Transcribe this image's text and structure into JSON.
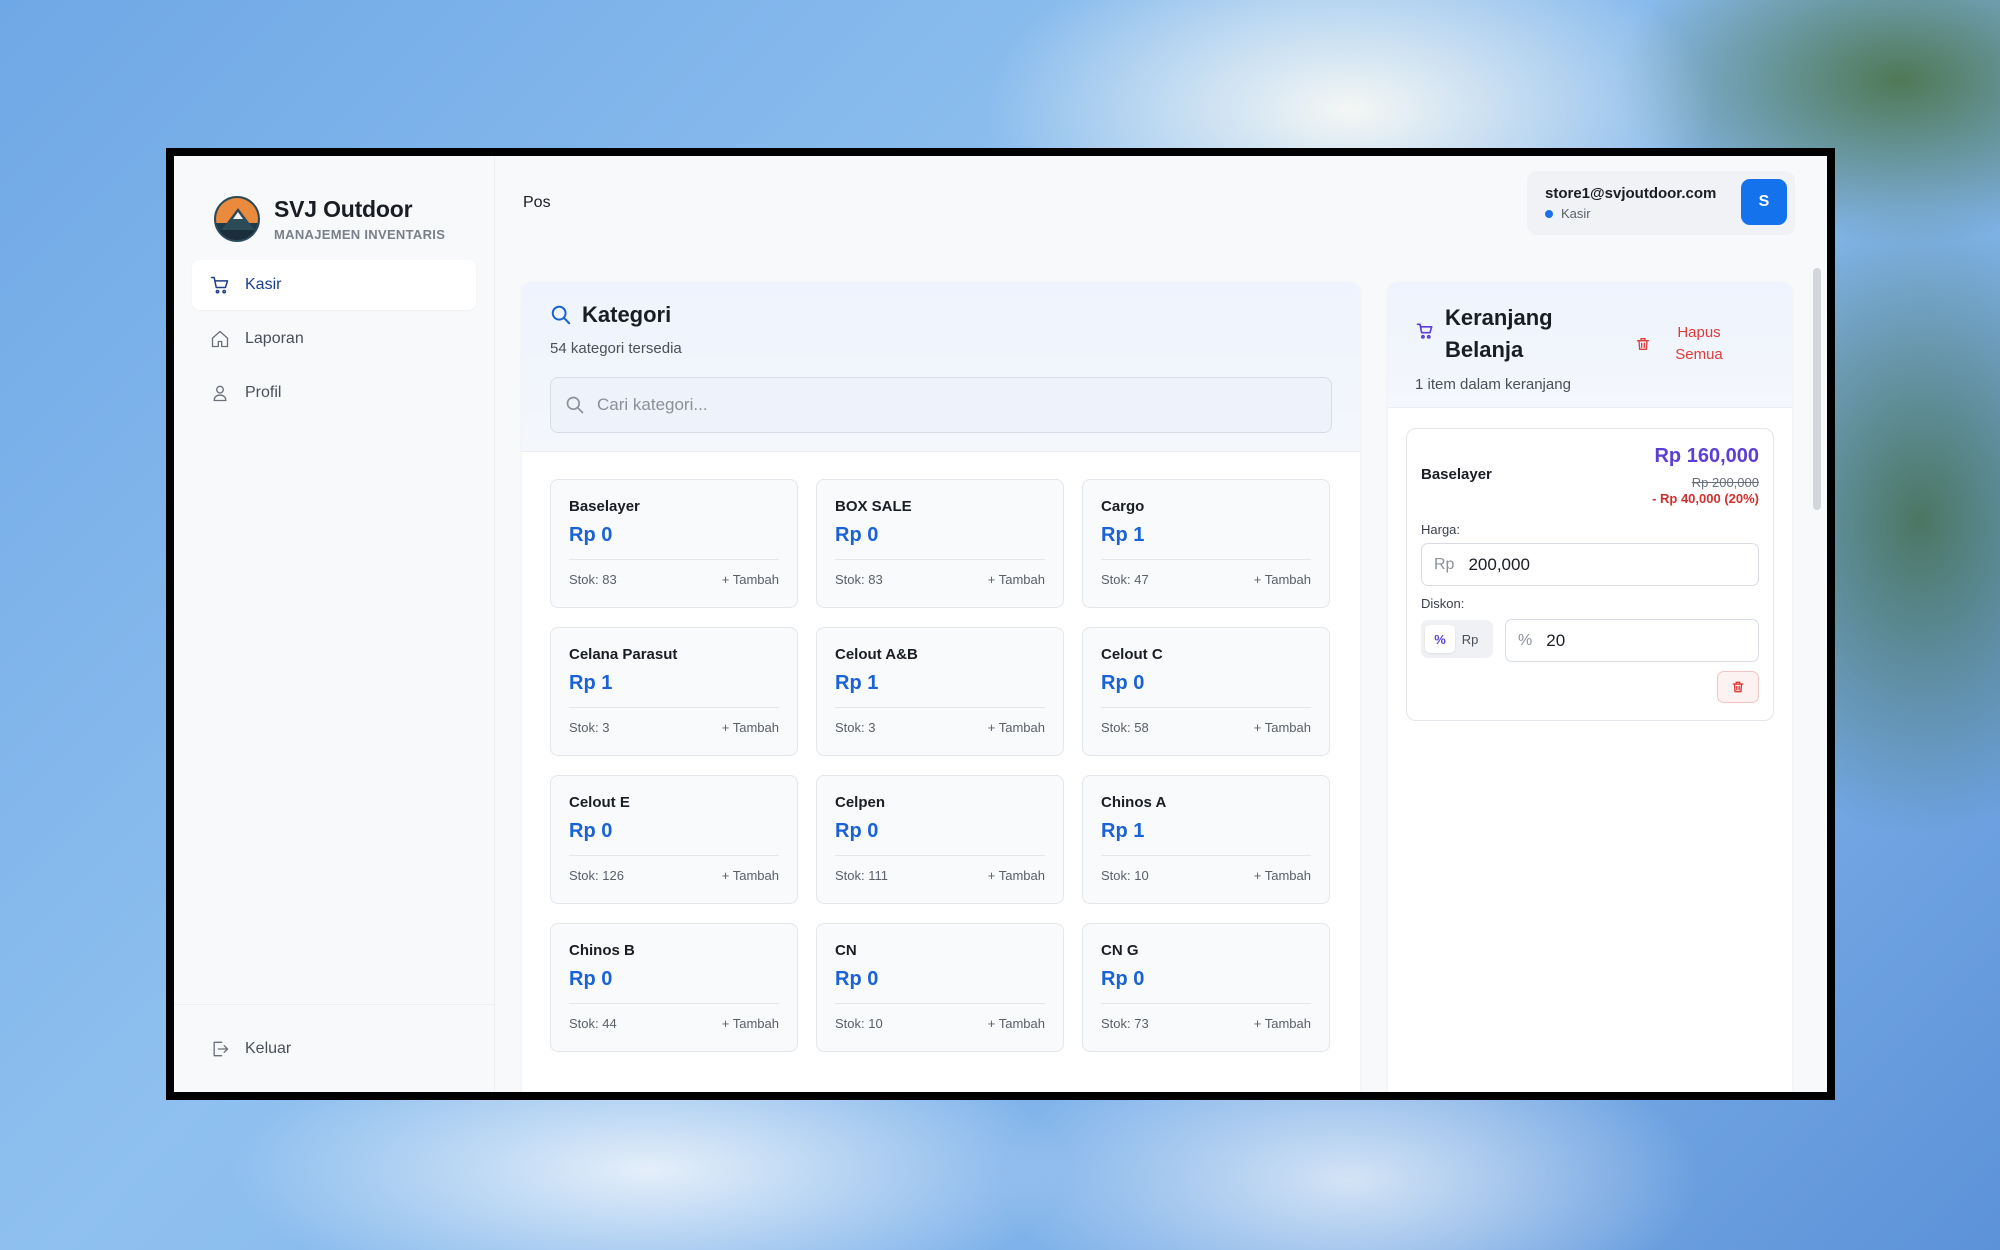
{
  "brand": {
    "title": "SVJ Outdoor",
    "subtitle": "MANAJEMEN INVENTARIS"
  },
  "sidebar": {
    "items": [
      {
        "label": "Kasir",
        "icon": "cart-icon",
        "active": true
      },
      {
        "label": "Laporan",
        "icon": "home-icon",
        "active": false
      },
      {
        "label": "Profil",
        "icon": "user-icon",
        "active": false
      }
    ],
    "logout_label": "Keluar"
  },
  "header": {
    "breadcrumb": "Pos",
    "user_email": "store1@svjoutdoor.com",
    "user_role": "Kasir",
    "avatar_initial": "S"
  },
  "categories": {
    "title": "Kategori",
    "count_text": "54 kategori tersedia",
    "search_placeholder": "Cari kategori...",
    "add_label": "+ Tambah",
    "items": [
      {
        "name": "Baselayer",
        "price": "Rp 0",
        "stock": "Stok: 83"
      },
      {
        "name": "BOX SALE",
        "price": "Rp 0",
        "stock": "Stok: 83"
      },
      {
        "name": "Cargo",
        "price": "Rp 1",
        "stock": "Stok: 47"
      },
      {
        "name": "Celana Parasut",
        "price": "Rp 1",
        "stock": "Stok: 3"
      },
      {
        "name": "Celout A&B",
        "price": "Rp 1",
        "stock": "Stok: 3"
      },
      {
        "name": "Celout C",
        "price": "Rp 0",
        "stock": "Stok: 58"
      },
      {
        "name": "Celout E",
        "price": "Rp 0",
        "stock": "Stok: 126"
      },
      {
        "name": "Celpen",
        "price": "Rp 0",
        "stock": "Stok: 111"
      },
      {
        "name": "Chinos A",
        "price": "Rp 1",
        "stock": "Stok: 10"
      },
      {
        "name": "Chinos B",
        "price": "Rp 0",
        "stock": "Stok: 44"
      },
      {
        "name": "CN",
        "price": "Rp 0",
        "stock": "Stok: 10"
      },
      {
        "name": "CN G",
        "price": "Rp 0",
        "stock": "Stok: 73"
      }
    ]
  },
  "cart": {
    "title": "Keranjang Belanja",
    "clear_label": "Hapus Semua",
    "count_text": "1 item dalam keranjang",
    "item": {
      "name": "Baselayer",
      "final_price": "Rp 160,000",
      "original_price": "Rp 200,000",
      "discount_text": "- Rp 40,000 (20%)",
      "price_label": "Harga:",
      "price_prefix": "Rp",
      "price_value": "200,000",
      "discount_label": "Diskon:",
      "discount_modes": [
        "%",
        "Rp"
      ],
      "discount_mode_selected": "%",
      "discount_prefix": "%",
      "discount_value": "20"
    }
  },
  "colors": {
    "accent_blue": "#1a62d6",
    "cart_price_purple": "#5b3fd6",
    "danger_red": "#e03a3a",
    "avatar_blue": "#1372ec"
  }
}
